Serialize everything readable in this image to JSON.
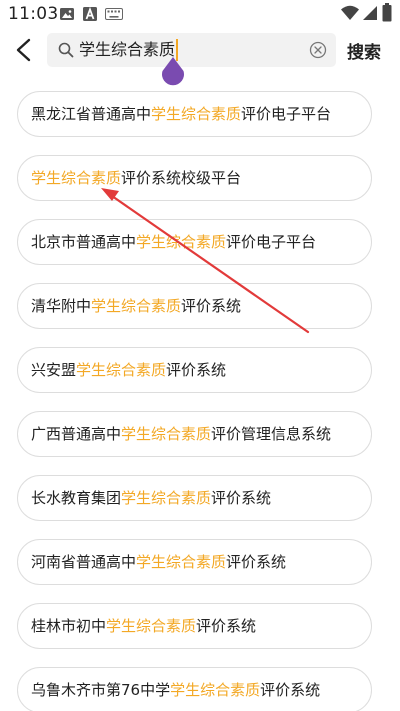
{
  "status_bar": {
    "time": "11:03"
  },
  "search": {
    "query": "学生综合素质",
    "button_label": "搜索"
  },
  "highlight_color": "#f3a825",
  "suggestions": [
    {
      "pre": "黑龙江省普通高中",
      "hl": "学生综合素质",
      "post": "评价电子平台"
    },
    {
      "pre": "",
      "hl": "学生综合素质",
      "post": "评价系统校级平台"
    },
    {
      "pre": "北京市普通高中",
      "hl": "学生综合素质",
      "post": "评价电子平台"
    },
    {
      "pre": "清华附中",
      "hl": "学生综合素质",
      "post": "评价系统"
    },
    {
      "pre": "兴安盟",
      "hl": "学生综合素质",
      "post": "评价系统"
    },
    {
      "pre": "广西普通高中",
      "hl": "学生综合素质",
      "post": "评价管理信息系统"
    },
    {
      "pre": "长水教育集团",
      "hl": "学生综合素质",
      "post": "评价系统"
    },
    {
      "pre": "河南省普通高中",
      "hl": "学生综合素质",
      "post": "评价系统"
    },
    {
      "pre": "桂林市初中",
      "hl": "学生综合素质",
      "post": "评价系统"
    },
    {
      "pre": "乌鲁木齐市第76中学",
      "hl": "学生综合素质",
      "post": "评价系统"
    }
  ],
  "icons": {
    "back": "chevron-left-icon",
    "search": "search-icon",
    "clear": "clear-circle-icon",
    "annotation": "red-arrow-annotation"
  }
}
